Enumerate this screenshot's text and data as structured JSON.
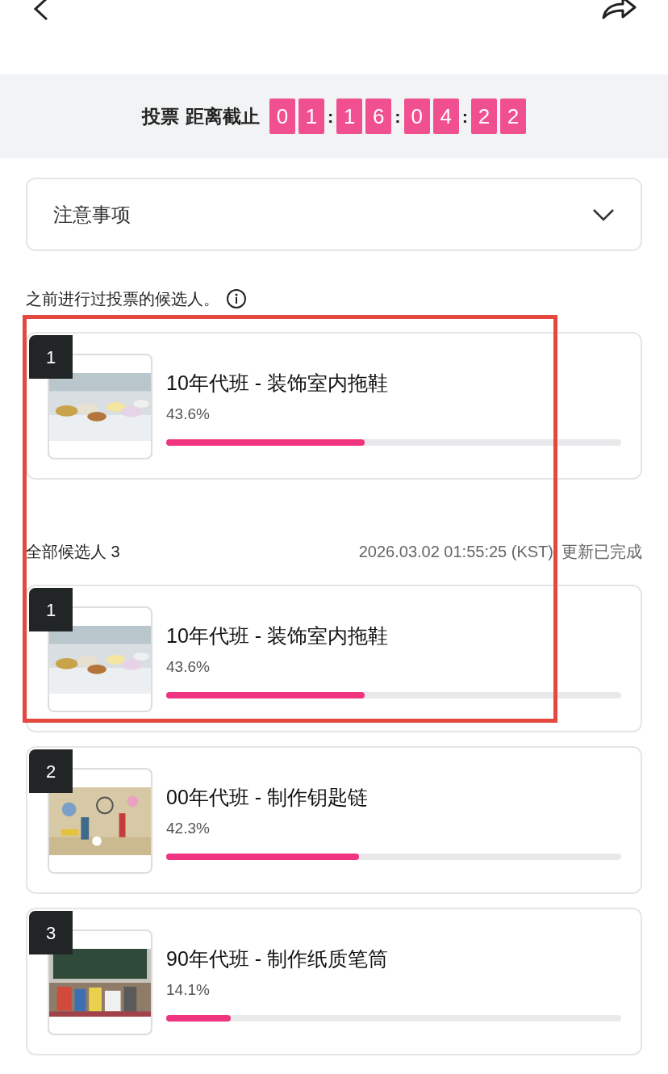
{
  "deadline": {
    "label": "投票 距离截止",
    "groups": [
      [
        "0",
        "1"
      ],
      [
        "1",
        "6"
      ],
      [
        "0",
        "4"
      ],
      [
        "2",
        "2"
      ]
    ],
    "separator": ":"
  },
  "notice": {
    "title": "注意事项",
    "expanded": false
  },
  "previous": {
    "title": "之前进行过投票的候选人。",
    "candidates": [
      {
        "rank": "1",
        "title": "10年代班 - 装饰室内拖鞋",
        "percent": "43.6%",
        "level": 0.436
      }
    ]
  },
  "all": {
    "title": "全部候选人 3",
    "timestamp": "2026.03.02 01:55:25 (KST)",
    "status": "更新已完成",
    "candidates": [
      {
        "rank": "1",
        "title": "10年代班 - 装饰室内拖鞋",
        "percent": "43.6%",
        "level": 0.436
      },
      {
        "rank": "2",
        "title": "00年代班 - 制作钥匙链",
        "percent": "42.3%",
        "level": 0.423
      },
      {
        "rank": "3",
        "title": "90年代班 - 制作纸质笔筒",
        "percent": "14.1%",
        "level": 0.141
      }
    ]
  }
}
